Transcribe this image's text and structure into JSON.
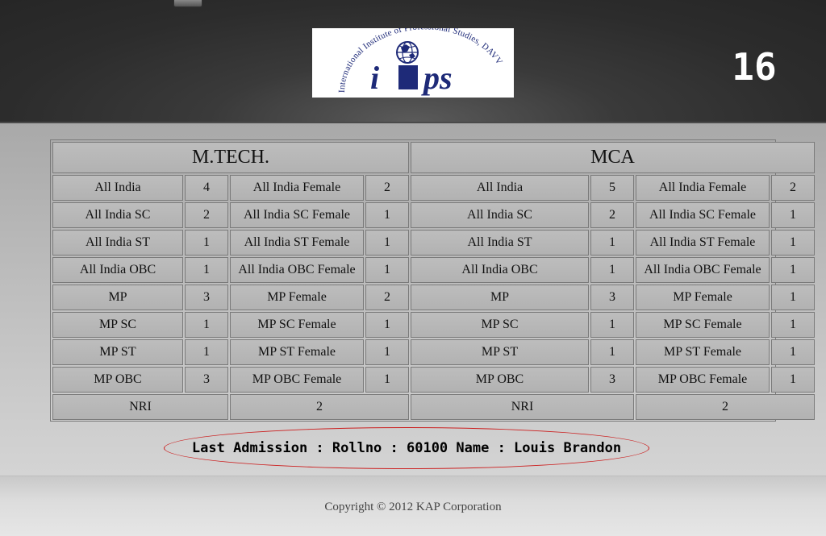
{
  "header": {
    "logo_text": "iips",
    "logo_arc_text": "International Institute of Professional Studies, DAVV",
    "counter": "16"
  },
  "colors": {
    "header_bg": "#2c2c2c",
    "logo_blue": "#1e2a78",
    "ellipse_border": "#cc2020"
  },
  "table": {
    "mtech_title": "M.TECH.",
    "mca_title": "MCA",
    "rows": [
      {
        "m_cat": "All India",
        "m_val": "4",
        "m_fcat": "All India Female",
        "m_fval": "2",
        "c_cat": "All India",
        "c_val": "5",
        "c_fcat": "All India Female",
        "c_fval": "2"
      },
      {
        "m_cat": "All India SC",
        "m_val": "2",
        "m_fcat": "All India SC Female",
        "m_fval": "1",
        "c_cat": "All India SC",
        "c_val": "2",
        "c_fcat": "All India SC Female",
        "c_fval": "1"
      },
      {
        "m_cat": "All India ST",
        "m_val": "1",
        "m_fcat": "All India ST Female",
        "m_fval": "1",
        "c_cat": "All India ST",
        "c_val": "1",
        "c_fcat": "All India ST Female",
        "c_fval": "1"
      },
      {
        "m_cat": "All India OBC",
        "m_val": "1",
        "m_fcat": "All India OBC Female",
        "m_fval": "1",
        "c_cat": "All India OBC",
        "c_val": "1",
        "c_fcat": "All India OBC Female",
        "c_fval": "1"
      },
      {
        "m_cat": "MP",
        "m_val": "3",
        "m_fcat": "MP Female",
        "m_fval": "2",
        "c_cat": "MP",
        "c_val": "3",
        "c_fcat": "MP Female",
        "c_fval": "1"
      },
      {
        "m_cat": "MP SC",
        "m_val": "1",
        "m_fcat": "MP SC Female",
        "m_fval": "1",
        "c_cat": "MP SC",
        "c_val": "1",
        "c_fcat": "MP SC Female",
        "c_fval": "1"
      },
      {
        "m_cat": "MP ST",
        "m_val": "1",
        "m_fcat": "MP ST Female",
        "m_fval": "1",
        "c_cat": "MP ST",
        "c_val": "1",
        "c_fcat": "MP ST Female",
        "c_fval": "1"
      },
      {
        "m_cat": "MP OBC",
        "m_val": "3",
        "m_fcat": "MP OBC Female",
        "m_fval": "1",
        "c_cat": "MP OBC",
        "c_val": "3",
        "c_fcat": "MP OBC Female",
        "c_fval": "1"
      }
    ],
    "nri": {
      "m_label": "NRI",
      "m_val": "2",
      "c_label": "NRI",
      "c_val": "2"
    }
  },
  "last_admission": "Last Admission : Rollno : 60100 Name : Louis Brandon",
  "footer": {
    "copyright": "Copyright © 2012 KAP Corporation"
  }
}
